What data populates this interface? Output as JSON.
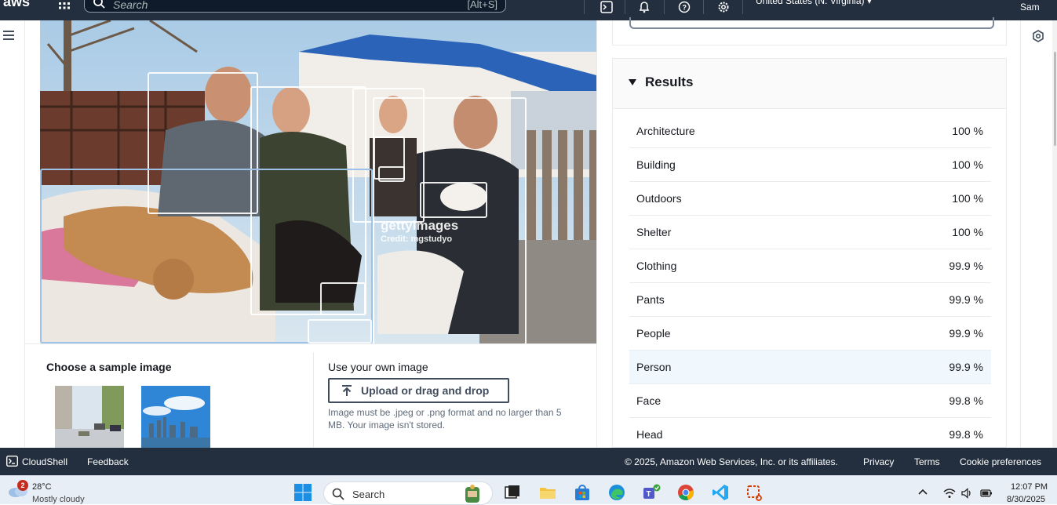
{
  "topnav": {
    "search_placeholder": "Search",
    "search_shortcut": "[Alt+S]",
    "region": "United States (N. Virginia) ▾",
    "user": "Sam"
  },
  "sample": {
    "choose_title": "Choose a sample image",
    "own_title": "Use your own image",
    "upload_label": "Upload or drag and drop",
    "upload_hint": "Image must be .jpeg or .png format and no larger than 5 MB. Your image isn't stored."
  },
  "photo": {
    "watermark_brand": "gettyimages",
    "watermark_credit": "Credit: mgstudyo"
  },
  "results": {
    "title": "Results",
    "rows": [
      {
        "label": "Architecture",
        "value": "100 %"
      },
      {
        "label": "Building",
        "value": "100 %"
      },
      {
        "label": "Outdoors",
        "value": "100 %"
      },
      {
        "label": "Shelter",
        "value": "100 %"
      },
      {
        "label": "Clothing",
        "value": "99.9 %"
      },
      {
        "label": "Pants",
        "value": "99.9 %"
      },
      {
        "label": "People",
        "value": "99.9 %"
      },
      {
        "label": "Person",
        "value": "99.9 %"
      },
      {
        "label": "Face",
        "value": "99.8 %"
      },
      {
        "label": "Head",
        "value": "99.8 %"
      }
    ]
  },
  "footer": {
    "cloudshell": "CloudShell",
    "feedback": "Feedback",
    "copyright": "© 2025, Amazon Web Services, Inc. or its affiliates.",
    "privacy": "Privacy",
    "terms": "Terms",
    "cookies": "Cookie preferences"
  },
  "taskbar": {
    "notification_count": "2",
    "temperature": "28°C",
    "condition": "Mostly cloudy",
    "search_label": "Search",
    "time": "12:07 PM",
    "date": "8/30/2025"
  },
  "colors": {
    "nav_bg": "#232f3e",
    "highlight_row": "#f1f8fd",
    "taskbar_bg": "#e8eef6"
  }
}
